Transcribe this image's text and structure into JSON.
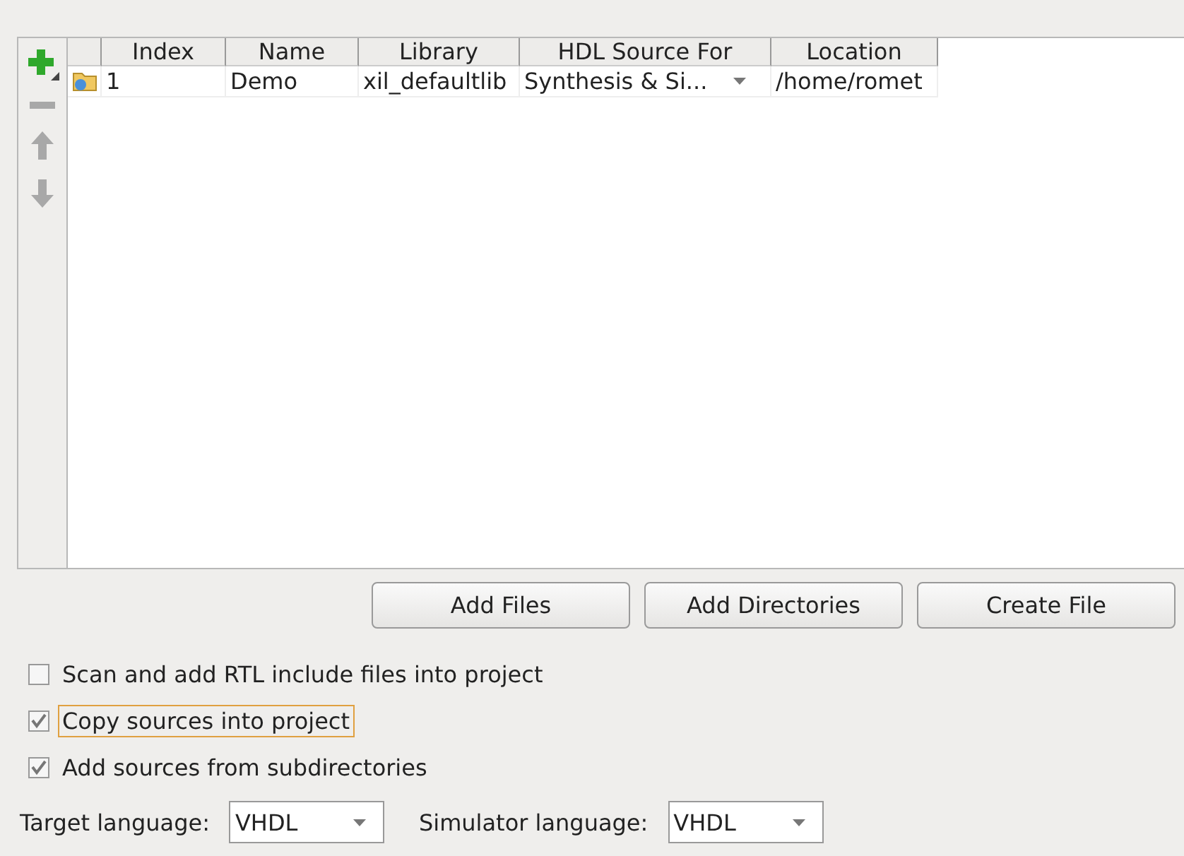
{
  "toolbar": [
    {
      "kind": "add"
    },
    {
      "kind": "remove",
      "disabled": true
    },
    {
      "kind": "up",
      "disabled": true
    },
    {
      "kind": "down",
      "disabled": true
    }
  ],
  "table": {
    "columns": [
      "Index",
      "Name",
      "Library",
      "HDL Source For",
      "Location"
    ],
    "rows": [
      {
        "index": "1",
        "name": "Demo",
        "library": "xil_defaultlib",
        "hdl_source_for": "Synthesis & Si...",
        "location": "/home/romet"
      }
    ]
  },
  "buttons": [
    "Add Files",
    "Add Directories",
    "Create File"
  ],
  "options": [
    {
      "label": "Scan and add RTL include files into project",
      "checked": false,
      "focused": false
    },
    {
      "label": "Copy sources into project",
      "checked": true,
      "focused": true
    },
    {
      "label": "Add sources from subdirectories",
      "checked": true,
      "focused": false
    }
  ],
  "target_language": {
    "label": "Target language:",
    "value": "VHDL"
  },
  "simulator_language": {
    "label": "Simulator language:",
    "value": "VHDL"
  }
}
